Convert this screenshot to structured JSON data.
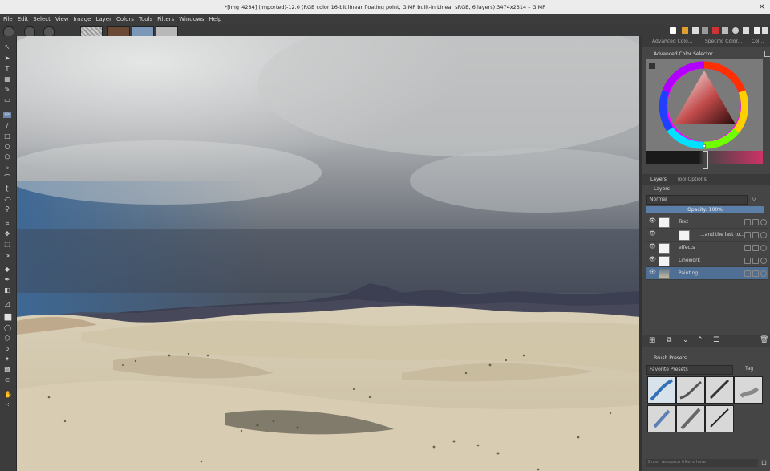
{
  "window": {
    "title": "*[img_4284] (imported)-12.0 (RGB color 16-bit linear floating point, GIMP built-in Linear sRGB, 6 layers) 3474x2314 – GIMP",
    "close": "×"
  },
  "menu": [
    "File",
    "Edit",
    "Select",
    "View",
    "Image",
    "Layer",
    "Colors",
    "Tools",
    "Filters",
    "Windows",
    "Help"
  ],
  "dock": {
    "top_tabs": [
      "Advanced Colo...",
      "Specific Color...",
      "Col..."
    ],
    "color_selector_title": "Advanced Color Selector",
    "layer_tabs": [
      "Layers",
      "Tool Options"
    ],
    "layers_title": "Layers",
    "mode": "Normal",
    "opacity_label": "Opacity: 100%",
    "layers": [
      {
        "name": "Text",
        "selected": false,
        "type": "group"
      },
      {
        "name": "...and the last to...",
        "selected": false,
        "type": "text"
      },
      {
        "name": "effects",
        "selected": false,
        "type": "group"
      },
      {
        "name": "Linework",
        "selected": false,
        "type": "group"
      },
      {
        "name": "Painting",
        "selected": true,
        "type": "image"
      }
    ],
    "brush_title": "Brush Presets",
    "brush_tag": "Favorite Presets",
    "brush_tag_btn": "Tag",
    "filter_placeholder": "Enter resource filters here"
  },
  "colors": {
    "accent": "#5b7fa8",
    "selection": "#4f6f94"
  }
}
